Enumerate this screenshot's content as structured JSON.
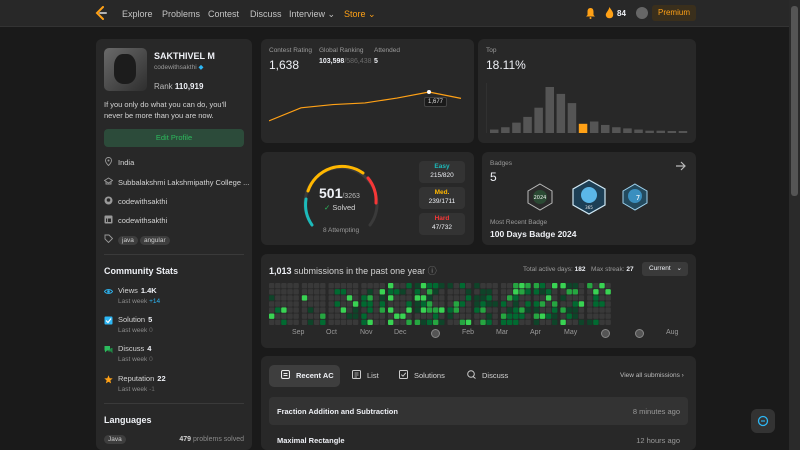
{
  "nav": {
    "links": [
      "Explore",
      "Problems",
      "Contest",
      "Discuss",
      "Interview",
      "Store"
    ],
    "streak": "84",
    "premium": "Premium"
  },
  "profile": {
    "name": "SAKTHIVEL M",
    "handle": "codewithsakthi",
    "rank_label": "Rank",
    "rank": "110,919",
    "bio": "If you only do what you can do, you'll never be more than you are now.",
    "edit": "Edit Profile",
    "location": "India",
    "school": "Subbalakshmi Lakshmipathy College ...",
    "github": "codewithsakthi",
    "linkedin": "codewithsakthi",
    "tags": [
      "java",
      "angular"
    ]
  },
  "community": {
    "title": "Community Stats",
    "items": [
      {
        "label": "Views",
        "value": "1.4K",
        "sub": "Last week",
        "delta": "+14",
        "color": "#2db7f5"
      },
      {
        "label": "Solution",
        "value": "5",
        "sub": "Last week",
        "delta": "0",
        "color": "#2db7f5"
      },
      {
        "label": "Discuss",
        "value": "4",
        "sub": "Last week",
        "delta": "0",
        "color": "#2cbb5d"
      },
      {
        "label": "Reputation",
        "value": "22",
        "sub": "Last week",
        "delta": "-1",
        "color": "#ffa116"
      }
    ]
  },
  "languages": {
    "title": "Languages",
    "lang": "Java",
    "count": "479",
    "count_suffix": "problems solved"
  },
  "contest": {
    "rating_label": "Contest Rating",
    "rating": "1,638",
    "global_label": "Global Ranking",
    "global": "103,598",
    "global_total": "/586,438",
    "attended_label": "Attended",
    "attended": "5",
    "tooltip": "1,677",
    "chart_data": {
      "type": "line",
      "values": [
        1500,
        1580,
        1600,
        1610,
        1640,
        1677,
        1638
      ]
    }
  },
  "top": {
    "label": "Top",
    "value": "18.11%",
    "chart_data": {
      "type": "bar",
      "values": [
        3,
        5,
        9,
        14,
        22,
        40,
        34,
        26,
        8,
        10,
        7,
        5,
        4,
        3,
        2,
        2,
        1,
        1
      ],
      "highlight": 8
    }
  },
  "solved": {
    "count": "501",
    "total": "/3263",
    "label": "Solved",
    "attempting": "8 Attempting",
    "easy": {
      "name": "Easy",
      "value": "215/820",
      "color": "#1cbaba"
    },
    "medium": {
      "name": "Med.",
      "value": "239/1711",
      "color": "#ffb700"
    },
    "hard": {
      "name": "Hard",
      "value": "47/732",
      "color": "#f63737"
    }
  },
  "badges": {
    "label": "Badges",
    "count": "5",
    "recent_label": "Most Recent Badge",
    "recent": "100 Days Badge 2024"
  },
  "submissions": {
    "count": "1,013",
    "label": "submissions in the past one year",
    "active_label": "Total active days:",
    "active": "182",
    "streak_label": "Max streak:",
    "streak": "27",
    "dropdown": "Current",
    "months": [
      "Sep",
      "Oct",
      "Nov",
      "Dec",
      "",
      "Feb",
      "Mar",
      "Apr",
      "May",
      "",
      "",
      "Aug"
    ]
  },
  "recent": {
    "tabs": [
      "Recent AC",
      "List",
      "Solutions",
      "Discuss"
    ],
    "view_all": "View all submissions",
    "items": [
      {
        "title": "Fraction Addition and Subtraction",
        "time": "8 minutes ago"
      },
      {
        "title": "Maximal Rectangle",
        "time": "12 hours ago"
      }
    ]
  }
}
